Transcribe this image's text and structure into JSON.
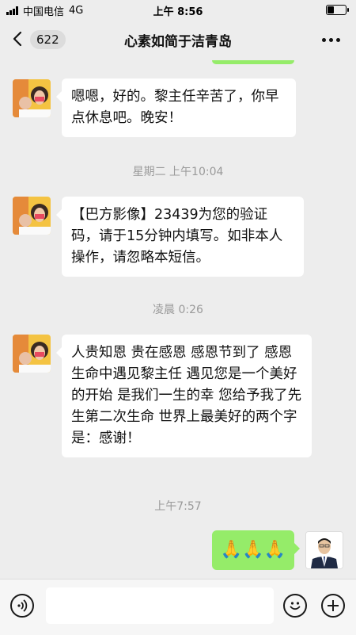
{
  "status_bar": {
    "carrier": "中国电信",
    "network": "4G",
    "time": "上午 8:56"
  },
  "nav": {
    "unread_count": "622",
    "title": "心素如简于洁青岛"
  },
  "messages": [
    {
      "type": "received",
      "text": "嗯嗯，好的。黎主任辛苦了，你早点休息吧。晚安！"
    },
    {
      "type": "time",
      "text": "星期二 上午10:04"
    },
    {
      "type": "received",
      "text": "【巴方影像】23439为您的验证码，请于15分钟内填写。如非本人操作，请忽略本短信。"
    },
    {
      "type": "time",
      "text": "凌晨 0:26"
    },
    {
      "type": "received",
      "text": "人贵知恩 贵在感恩 感恩节到了 感恩生命中遇见黎主任 遇见您是一个美好的开始 是我们一生的幸 您给予我了先生第二次生命 世界上最美好的两个字是：感谢！"
    },
    {
      "type": "time",
      "text": "上午7:57"
    },
    {
      "type": "sent",
      "emoji": "🙏🙏🙏",
      "icon": "praying-hands-emoji"
    }
  ],
  "input": {
    "placeholder": ""
  },
  "colors": {
    "background": "#ededed",
    "sent_bubble": "#95ec69",
    "received_bubble": "#ffffff",
    "timestamp": "#9a9a9a"
  }
}
